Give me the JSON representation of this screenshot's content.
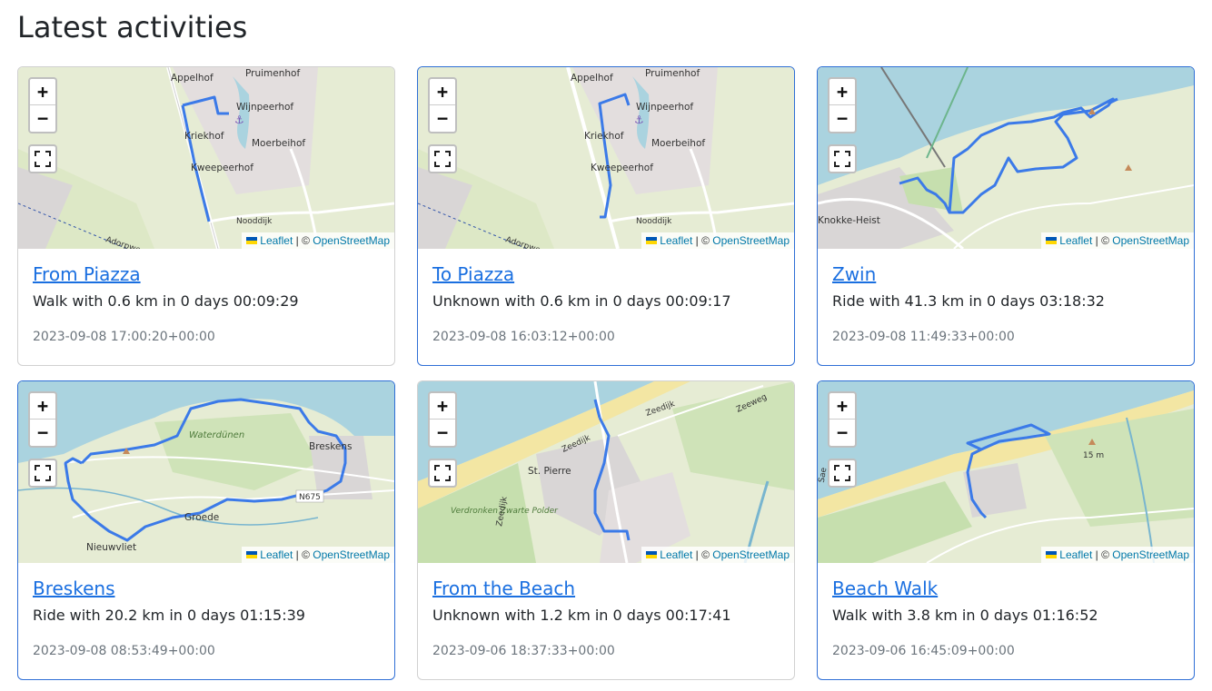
{
  "page": {
    "title": "Latest activities"
  },
  "map_controls": {
    "zoom_in": "+",
    "zoom_out": "−",
    "attribution": {
      "leaflet": "Leaflet",
      "separator": "| ©",
      "osm": "OpenStreetMap"
    }
  },
  "colors": {
    "route": "#3b7ae8",
    "link": "#1a6fe0",
    "water": "#aad3df",
    "land": "#e6ecd4",
    "residential": "#e0dfdf",
    "active_border": "#2f6fd6"
  },
  "activities": [
    {
      "title": "From Piazza",
      "description": "Walk with 0.6 km in 0 days 00:09:29",
      "timestamp": "2023-09-08 17:00:20+00:00",
      "map_labels": [
        "Appelhof",
        "Pruimenhof",
        "Wijnpeerhof",
        "Kriekhof",
        "Moerbeihof",
        "Kweepeerhof",
        "Nooddijk",
        "Adorpweg"
      ]
    },
    {
      "title": "To Piazza",
      "description": "Unknown with 0.6 km in 0 days 00:09:17",
      "timestamp": "2023-09-08 16:03:12+00:00",
      "map_labels": [
        "Appelhof",
        "Pruimenhof",
        "Wijnpeerhof",
        "Kriekhof",
        "Moerbeihof",
        "Kweepeerhof",
        "Nooddijk",
        "Adorpweg"
      ]
    },
    {
      "title": "Zwin",
      "description": "Ride with 41.3 km in 0 days 03:18:32",
      "timestamp": "2023-09-08 11:49:33+00:00",
      "map_labels": [
        "Knokke-Heist"
      ]
    },
    {
      "title": "Breskens",
      "description": "Ride with 20.2 km in 0 days 01:15:39",
      "timestamp": "2023-09-08 08:53:49+00:00",
      "map_labels": [
        "Waterdünen",
        "Breskens",
        "N675",
        "Groede",
        "Nieuwvliet"
      ]
    },
    {
      "title": "From the Beach",
      "description": "Unknown with 1.2 km in 0 days 00:17:41",
      "timestamp": "2023-09-06 18:37:33+00:00",
      "map_labels": [
        "Zeeweg",
        "Zeedijk",
        "Zeedijk",
        "St. Pierre",
        "Verdronken Zwarte Polder",
        "Zeedijk"
      ]
    },
    {
      "title": "Beach Walk",
      "description": "Walk with 3.8 km in 0 days 01:16:52",
      "timestamp": "2023-09-06 16:45:09+00:00",
      "map_labels": [
        "15 m",
        "Sae"
      ]
    }
  ]
}
